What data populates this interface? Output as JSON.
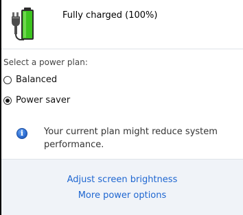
{
  "battery": {
    "status": "Fully charged (100%)",
    "icon": "battery-charging-icon",
    "level_fraction": 1.0,
    "fill_color": "#3cc41f"
  },
  "power_plan": {
    "label": "Select a power plan:",
    "options": [
      {
        "label": "Balanced",
        "selected": false
      },
      {
        "label": "Power saver",
        "selected": true
      }
    ],
    "info_icon": "info-icon",
    "info_text": "Your current plan might reduce system performance."
  },
  "footer": {
    "links": [
      {
        "label": "Adjust screen brightness"
      },
      {
        "label": "More power options"
      }
    ],
    "link_color": "#1e66d1"
  }
}
